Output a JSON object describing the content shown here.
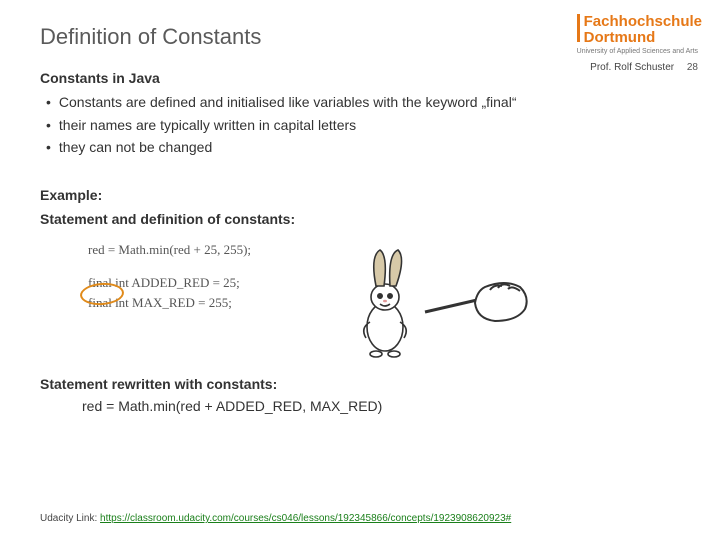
{
  "logo": {
    "line1": "Fachhochschule",
    "line2": "Dortmund",
    "sub": "University of Applied Sciences and Arts"
  },
  "byline": {
    "author": "Prof. Rolf Schuster",
    "page": "28"
  },
  "title": "Definition of Constants",
  "subhead": "Constants in Java",
  "bullets": [
    "Constants are defined and initialised like variables with the keyword „final“",
    "their names are typically written in capital letters",
    "they can not be changed"
  ],
  "example_label": "Example:",
  "stmt_label": "Statement and definition of constants:",
  "code": {
    "l1": "red = Math.min(red + 25, 255);",
    "l2a": "final",
    "l2b": " int ADDED_RED = 25;",
    "l3": "final int MAX_RED = 255;"
  },
  "rewritten_label": "Statement rewritten with constants:",
  "rewritten_code": "red = Math.min(red + ADDED_RED, MAX_RED)",
  "footer": {
    "label": "Udacity Link: ",
    "url": "https://classroom.udacity.com/courses/cs046/lessons/192345866/concepts/1923908620923#"
  }
}
